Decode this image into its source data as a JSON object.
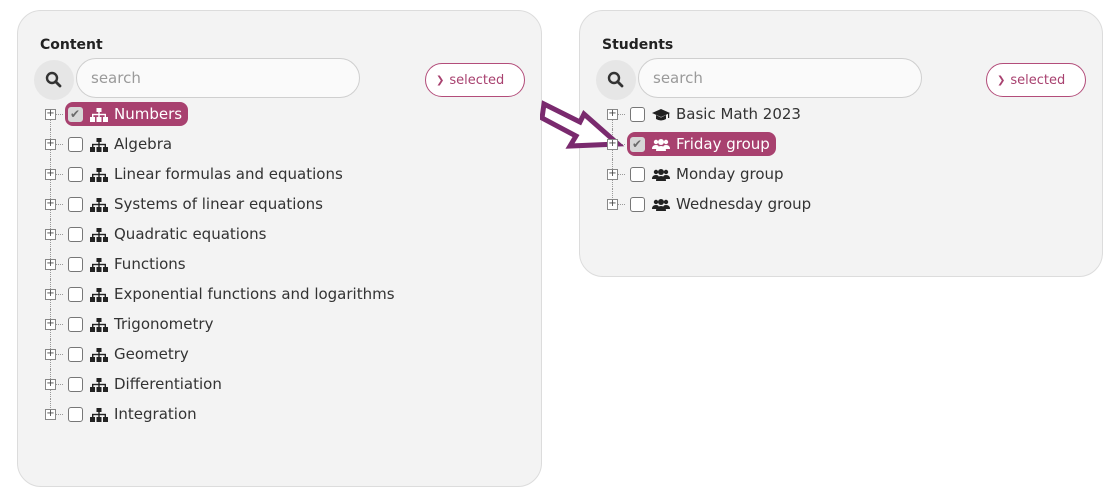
{
  "content_panel": {
    "title": "Content",
    "search_placeholder": "search",
    "selected_label": "selected",
    "items": [
      {
        "label": "Numbers",
        "selected": true
      },
      {
        "label": "Algebra",
        "selected": false
      },
      {
        "label": "Linear formulas and equations",
        "selected": false
      },
      {
        "label": "Systems of linear equations",
        "selected": false
      },
      {
        "label": "Quadratic equations",
        "selected": false
      },
      {
        "label": "Functions",
        "selected": false
      },
      {
        "label": "Exponential functions and logarithms",
        "selected": false
      },
      {
        "label": "Trigonometry",
        "selected": false
      },
      {
        "label": "Geometry",
        "selected": false
      },
      {
        "label": "Differentiation",
        "selected": false
      },
      {
        "label": "Integration",
        "selected": false
      }
    ]
  },
  "students_panel": {
    "title": "Students",
    "search_placeholder": "search",
    "selected_label": "selected",
    "items": [
      {
        "label": "Basic Math 2023",
        "selected": false,
        "icon": "graduation-cap-icon"
      },
      {
        "label": "Friday group",
        "selected": true,
        "icon": "users-icon"
      },
      {
        "label": "Monday group",
        "selected": false,
        "icon": "users-icon"
      },
      {
        "label": "Wednesday group",
        "selected": false,
        "icon": "users-icon"
      }
    ]
  },
  "colors": {
    "accent": "#a8416f",
    "arrow": "#7a2a6e",
    "panel_bg": "#f3f3f3"
  }
}
